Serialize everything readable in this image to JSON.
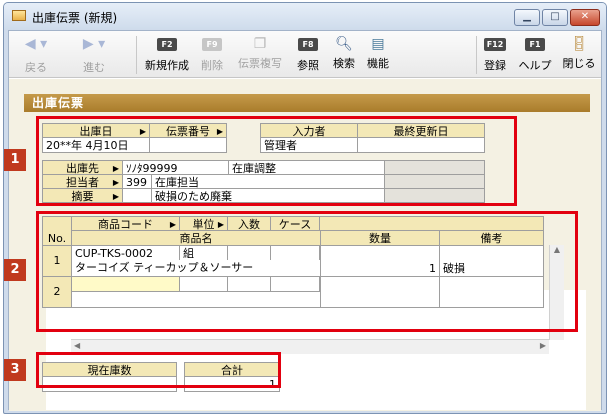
{
  "window": {
    "title": "出庫伝票 (新規)",
    "min_glyph": "▁",
    "max_glyph": "□",
    "close_glyph": "✕"
  },
  "toolbar": {
    "back": "戻る",
    "forward": "進む",
    "new": {
      "key": "F2",
      "label": "新規作成"
    },
    "delete": {
      "key": "F9",
      "label": "削除"
    },
    "copy": {
      "label": "伝票複写"
    },
    "ref": {
      "key": "F8",
      "label": "参照"
    },
    "search": {
      "label": "検索"
    },
    "func": {
      "label": "機能"
    },
    "register": {
      "key": "F12",
      "label": "登録"
    },
    "help": {
      "key": "F1",
      "label": "ヘルプ"
    },
    "close": {
      "label": "閉じる"
    }
  },
  "panel": {
    "title": "出庫伝票"
  },
  "header": {
    "date_label": "出庫日",
    "date_value": "20**年  4月10日",
    "slip_no_label": "伝票番号",
    "slip_no_value": "",
    "inputter_label": "入力者",
    "inputter_value": "管理者",
    "updated_label": "最終更新日",
    "updated_value": "",
    "dest_label": "出庫先",
    "dest_code": "ｿﾉﾀ99999",
    "dest_name": "在庫調整",
    "staff_label": "担当者",
    "staff_code": "399",
    "staff_name": "在庫担当",
    "summary_label": "摘要",
    "summary_code": "",
    "summary_text": "破損のため廃棄"
  },
  "grid": {
    "col_no": "No.",
    "col_code": "商品コード",
    "col_unit": "単位",
    "col_qty_in": "入数",
    "col_case": "ケース",
    "col_name": "商品名",
    "col_qty": "数量",
    "col_note": "備考",
    "rows": [
      {
        "no": "1",
        "code": "CUP-TKS-0002",
        "unit": "組",
        "name": "ターコイズ ティーカップ＆ソーサー",
        "qty": "1",
        "note": "破損"
      },
      {
        "no": "2",
        "code": "",
        "unit": "",
        "name": "",
        "qty": "",
        "note": ""
      }
    ]
  },
  "footer": {
    "stock_label": "現在庫数",
    "stock_value": "",
    "total_label": "合計",
    "total_value": "1"
  },
  "badges": [
    "1",
    "2",
    "3"
  ],
  "colors": {
    "accent_red": "#e2000f",
    "badge": "#c0391e",
    "title_bar": "#b08535"
  }
}
